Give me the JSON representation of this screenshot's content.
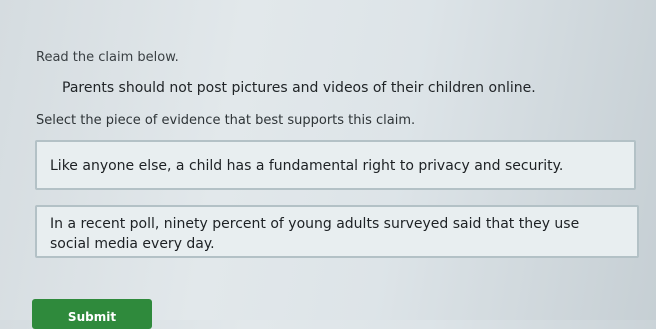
{
  "question": {
    "instruction": "Read the claim below.",
    "claim": "Parents should not post pictures and videos of their children online.",
    "prompt": "Select the piece of evidence that best supports this claim."
  },
  "choices": [
    {
      "text": "Like anyone else, a child has a fundamental right to privacy and security."
    },
    {
      "text": "In a recent poll, ninety percent of young adults surveyed said that they use social media every day."
    }
  ],
  "actions": {
    "submit_label": "Submit"
  }
}
